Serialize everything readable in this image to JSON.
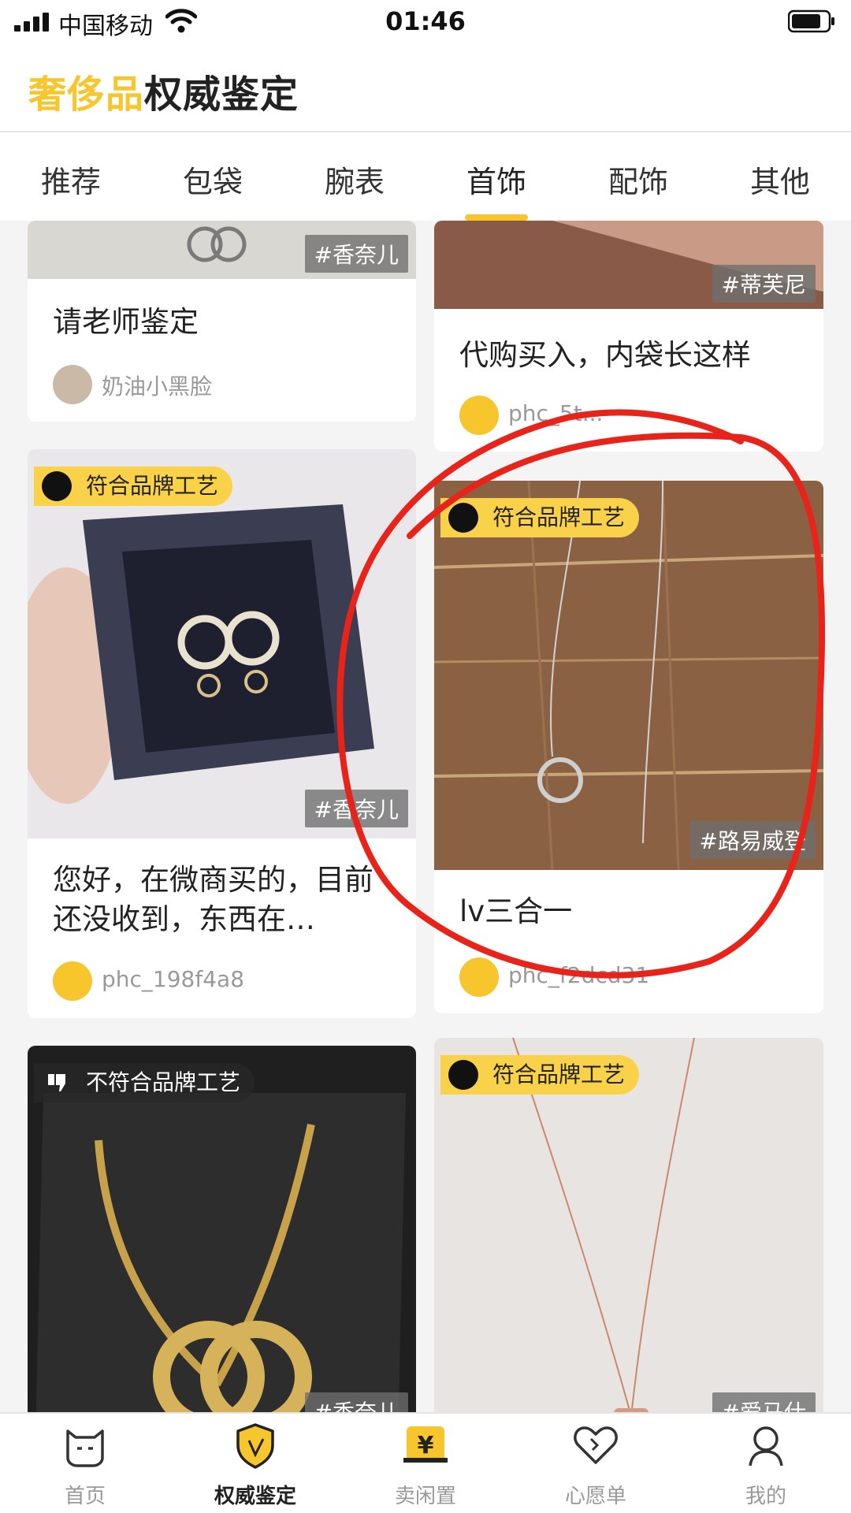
{
  "status_bar": {
    "carrier": "中国移动",
    "time": "01:46"
  },
  "header": {
    "title_accent": "奢侈品",
    "title_rest": "权威鉴定"
  },
  "tabs": [
    {
      "label": "推荐"
    },
    {
      "label": "包袋"
    },
    {
      "label": "腕表"
    },
    {
      "label": "首饰",
      "active": true
    },
    {
      "label": "配饰"
    },
    {
      "label": "其他"
    }
  ],
  "cards": [
    {
      "brand_tag": "#香奈儿",
      "caption": "请老师鉴定",
      "user": "奶油小黑脸"
    },
    {
      "brand_tag": "#蒂芙尼",
      "caption": "代购买入，内袋长这样",
      "user": "phc_5t..."
    },
    {
      "verdict": "符合品牌工艺",
      "brand_tag": "#香奈儿",
      "caption": "您好，在微商买的，目前还没收到，东西在…",
      "user": "phc_198f4a8"
    },
    {
      "verdict": "符合品牌工艺",
      "brand_tag": "#路易威登",
      "caption": "lv三合一",
      "user": "phc_f2dcd31"
    },
    {
      "verdict": "不符合品牌工艺",
      "brand_tag": "#香奈儿"
    },
    {
      "verdict": "符合品牌工艺",
      "brand_tag": "#爱马仕"
    }
  ],
  "bottom_nav": [
    {
      "label": "首页",
      "icon": "cat-face-icon"
    },
    {
      "label": "权威鉴定",
      "icon": "shield-icon",
      "active": true
    },
    {
      "label": "卖闲置",
      "icon": "yen-box-icon"
    },
    {
      "label": "心愿单",
      "icon": "heart-icon"
    },
    {
      "label": "我的",
      "icon": "profile-icon"
    }
  ],
  "colors": {
    "accent": "#f7c62c",
    "annotation": "#e8231a"
  }
}
